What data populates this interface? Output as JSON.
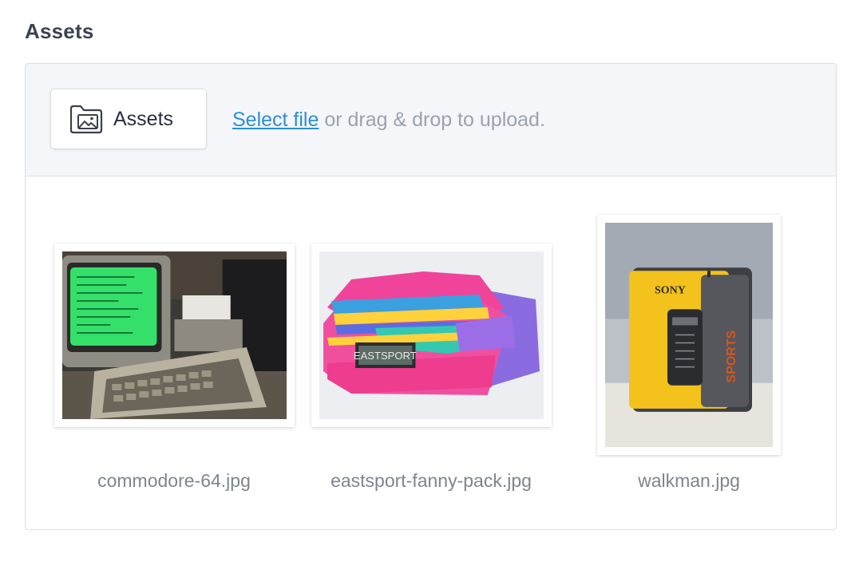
{
  "section": {
    "title": "Assets"
  },
  "upload": {
    "button_label": "Assets",
    "button_icon": "folder-image-icon",
    "select_link": "Select file",
    "hint": " or drag & drop to upload."
  },
  "assets": [
    {
      "filename": "commodore-64.jpg"
    },
    {
      "filename": "eastsport-fanny-pack.jpg"
    },
    {
      "filename": "walkman.jpg"
    }
  ],
  "colors": {
    "link": "#2b8fd9",
    "muted_text": "#9aa3ad",
    "heading": "#3a4450",
    "panel_border": "#dcdfe4",
    "upload_bg": "#f5f6f9"
  }
}
